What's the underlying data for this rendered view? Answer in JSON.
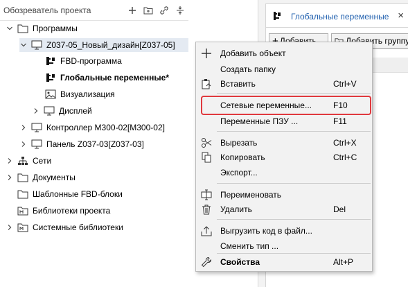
{
  "explorer": {
    "title": "Обозреватель проекта",
    "header_icons": [
      "plus-icon",
      "new-folder-icon",
      "link-icon",
      "collapse-icon"
    ],
    "tree": [
      {
        "label": "Программы",
        "icon": "folder-icon",
        "expanded": true
      },
      {
        "label": "Z037-05_Новый_дизайн[Z037-05]",
        "icon": "monitor-icon",
        "expanded": true,
        "selected": true
      },
      {
        "label": "FBD-программа",
        "icon": "fbd-icon"
      },
      {
        "label": "Глобальные переменные*",
        "icon": "fbd-icon",
        "bold": true
      },
      {
        "label": "Визуализация",
        "icon": "image-icon"
      },
      {
        "label": "Дисплей",
        "icon": "monitor-icon",
        "expanded": false
      },
      {
        "label": "Контроллер М300-02[M300-02]",
        "icon": "monitor-icon",
        "expanded": false
      },
      {
        "label": "Панель Z037-03[Z037-03]",
        "icon": "monitor-icon",
        "expanded": false
      },
      {
        "label": "Сети",
        "icon": "network-icon",
        "expanded": false
      },
      {
        "label": "Документы",
        "icon": "folder-icon",
        "expanded": false
      },
      {
        "label": "Шаблонные FBD-блоки",
        "icon": "folder-icon"
      },
      {
        "label": "Библиотеки проекта",
        "icon": "library-icon"
      },
      {
        "label": "Системные библиотеки",
        "icon": "library-icon",
        "expanded": false
      }
    ]
  },
  "right_panel": {
    "tab_label": "Глобальные переменные",
    "close_glyph": "×",
    "add_button": "Добавить",
    "add_group_button": "Добавить группу"
  },
  "context_menu": {
    "items": [
      {
        "label": "Добавить объект",
        "shortcut": "",
        "icon": "plus-icon"
      },
      {
        "label": "Создать папку",
        "shortcut": "",
        "icon": ""
      },
      {
        "label": "Вставить",
        "shortcut": "Ctrl+V",
        "icon": "paste-icon"
      },
      {
        "label": "Сетевые переменные...",
        "shortcut": "F10",
        "icon": "",
        "highlighted": true
      },
      {
        "label": "Переменные ПЗУ ...",
        "shortcut": "F11",
        "icon": ""
      },
      {
        "label": "Вырезать",
        "shortcut": "Ctrl+X",
        "icon": "scissors-icon"
      },
      {
        "label": "Копировать",
        "shortcut": "Ctrl+C",
        "icon": "copy-icon"
      },
      {
        "label": "Экспорт...",
        "shortcut": "",
        "icon": ""
      },
      {
        "label": "Переименовать",
        "shortcut": "",
        "icon": "rename-icon"
      },
      {
        "label": "Удалить",
        "shortcut": "Del",
        "icon": "trash-icon"
      },
      {
        "label": "Выгрузить код в файл...",
        "shortcut": "",
        "icon": "upload-icon"
      },
      {
        "label": "Сменить тип ...",
        "shortcut": "",
        "icon": ""
      },
      {
        "label": "Свойства",
        "shortcut": "Alt+P",
        "icon": "wrench-icon",
        "bold": true
      }
    ]
  },
  "colors": {
    "highlight_border": "#e0393e",
    "tab_label": "#1f5fae",
    "selection": "#e4eaf2"
  }
}
